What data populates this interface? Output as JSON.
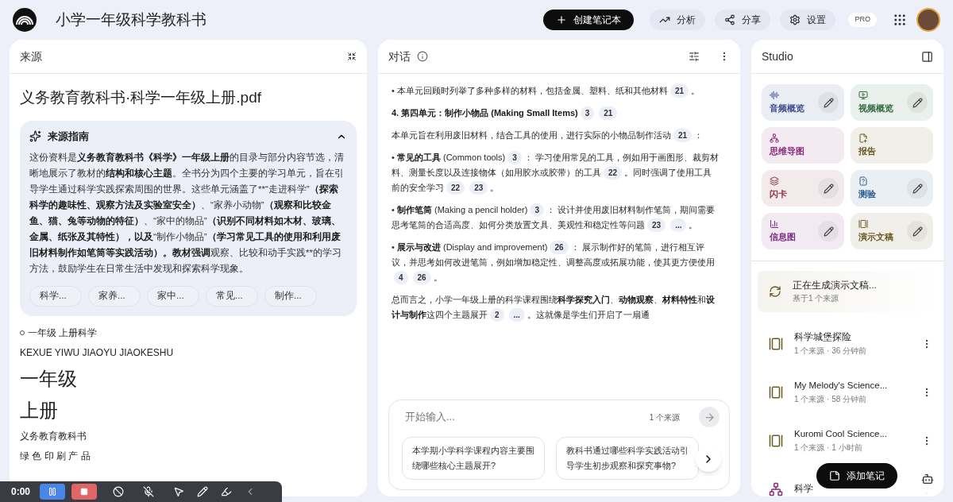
{
  "header": {
    "title": "小学一年级科学教科书",
    "actions": [
      {
        "kind": "primary",
        "label": "创建笔记本"
      },
      {
        "kind": "analytics",
        "label": "分析"
      },
      {
        "kind": "share",
        "label": "分享"
      },
      {
        "kind": "settings",
        "label": "设置"
      }
    ],
    "badge": "PRO"
  },
  "sources": {
    "title": "来源",
    "file_title": "义务教育教科书·科学一年级上册.pdf",
    "guide": {
      "title": "来源指南",
      "expanded": true,
      "parts": [
        {
          "text": "这份资料是",
          "bold": false
        },
        {
          "text": "义务教育教科书《科学》一年级上册",
          "bold": true
        },
        {
          "text": "的目录与部分内容节选，清晰地展示了教材的",
          "bold": false
        },
        {
          "text": "结构和核心主题",
          "bold": true
        },
        {
          "text": "。全书分为四个主要的学习单元，旨在引导学生通过科学实践探索周围的世界。这些单元涵盖了**“走进科学”",
          "bold": false
        },
        {
          "text": "（探索科学的趣味性、观察方法及实验室安全）",
          "bold": true
        },
        {
          "text": "、“家养小动物”",
          "bold": false
        },
        {
          "text": "（观察和比较金鱼、猫、兔等动物的特征）",
          "bold": true
        },
        {
          "text": "、“家中的物品”",
          "bold": false
        },
        {
          "text": "（识别不同材料如木材、玻璃、金属、纸张及其特性），以及",
          "bold": true
        },
        {
          "text": "“制作小物品”",
          "bold": false
        },
        {
          "text": "（学习常见工具的使用和利用废旧材料制作如笔筒等实践活动）。教材强调",
          "bold": true
        },
        {
          "text": "观察、比较和动手实践**的学习方法，鼓励学生在日常生活中发现和探索科学现象。",
          "bold": false
        }
      ],
      "chips": [
        "科学...",
        "家养...",
        "家中...",
        "常见...",
        "制作..."
      ]
    },
    "content": [
      {
        "kind": "marked",
        "text": "一年级 上册科学"
      },
      {
        "kind": "body",
        "text": "KEXUE YIWU JIAOYU JIAOKESHU"
      },
      {
        "kind": "heading",
        "text": "一年级"
      },
      {
        "kind": "heading",
        "text": "上册"
      },
      {
        "kind": "body",
        "text": "义务教育教科书"
      },
      {
        "kind": "body",
        "text": "绿 色 印 刷 产 品"
      }
    ]
  },
  "chat": {
    "title": "对话",
    "paragraphs": [
      {
        "parts": [
          {
            "kind": "text",
            "text": "• 本单元回顾时列举了多种多样的材料，包括金属、塑料、纸和其他材料",
            "bold": false
          },
          {
            "kind": "cite",
            "text": "21"
          },
          {
            "kind": "text",
            "text": "。",
            "bold": false
          }
        ]
      },
      {
        "parts": [
          {
            "kind": "text",
            "text": "4. 第四单元：制作小物品 (Making Small Items)",
            "bold": true
          },
          {
            "kind": "cite",
            "text": "3"
          },
          {
            "kind": "cite",
            "text": "21"
          }
        ]
      },
      {
        "parts": [
          {
            "kind": "text",
            "text": "本单元旨在利用废旧材料，结合工具的使用，进行实际的小物品制作活动",
            "bold": false
          },
          {
            "kind": "cite",
            "text": "21"
          },
          {
            "kind": "text",
            "text": "：",
            "bold": false
          }
        ]
      },
      {
        "parts": [
          {
            "kind": "text",
            "text": "• ",
            "bold": false
          },
          {
            "kind": "text",
            "text": "常见的工具",
            "bold": true
          },
          {
            "kind": "text",
            "text": " (Common tools)",
            "bold": false
          },
          {
            "kind": "cite",
            "text": "3"
          },
          {
            "kind": "text",
            "text": "： 学习使用常见的工具，例如用于画图形、裁剪材料、测量长度以及连接物体（如用胶水或胶带）的工具",
            "bold": false
          },
          {
            "kind": "cite",
            "text": "22"
          },
          {
            "kind": "text",
            "text": "。同时强调了使用工具前的安全学习",
            "bold": false
          },
          {
            "kind": "cite",
            "text": "22"
          },
          {
            "kind": "cite",
            "text": "23"
          },
          {
            "kind": "text",
            "text": "。",
            "bold": false
          }
        ]
      },
      {
        "parts": [
          {
            "kind": "text",
            "text": "• ",
            "bold": false
          },
          {
            "kind": "text",
            "text": "制作笔筒",
            "bold": true
          },
          {
            "kind": "text",
            "text": " (Making a pencil holder)",
            "bold": false
          },
          {
            "kind": "cite",
            "text": "3"
          },
          {
            "kind": "text",
            "text": "： 设计并使用废旧材料制作笔筒，期间需要思考笔筒的合适高度、如何分类放置文具、美观性和稳定性等问题",
            "bold": false
          },
          {
            "kind": "cite",
            "text": "23"
          },
          {
            "kind": "cite",
            "text": "..."
          },
          {
            "kind": "text",
            "text": "。",
            "bold": false
          }
        ]
      },
      {
        "parts": [
          {
            "kind": "text",
            "text": "• ",
            "bold": false
          },
          {
            "kind": "text",
            "text": "展示与改进",
            "bold": true
          },
          {
            "kind": "text",
            "text": " (Display and improvement)",
            "bold": false
          },
          {
            "kind": "cite",
            "text": "26"
          },
          {
            "kind": "text",
            "text": "： 展示制作好的笔筒，进行相互评议，并思考如何改进笔筒，例如增加稳定性、调整高度或拓展功能，使其更方便使用",
            "bold": false
          },
          {
            "kind": "cite",
            "text": "4"
          },
          {
            "kind": "cite",
            "text": "26"
          },
          {
            "kind": "text",
            "text": "。",
            "bold": false
          }
        ]
      },
      {
        "parts": [
          {
            "kind": "text",
            "text": "总而言之，小学一年级上册的科学课程围绕",
            "bold": false
          },
          {
            "kind": "text",
            "text": "科学探究入门",
            "bold": true
          },
          {
            "kind": "text",
            "text": "、",
            "bold": false
          },
          {
            "kind": "text",
            "text": "动物观察",
            "bold": true
          },
          {
            "kind": "text",
            "text": "、",
            "bold": false
          },
          {
            "kind": "text",
            "text": "材料特性",
            "bold": true
          },
          {
            "kind": "text",
            "text": "和",
            "bold": false
          },
          {
            "kind": "text",
            "text": "设计与制作",
            "bold": true
          },
          {
            "kind": "text",
            "text": "这四个主题展开",
            "bold": false
          },
          {
            "kind": "cite",
            "text": "2"
          },
          {
            "kind": "cite",
            "text": "..."
          },
          {
            "kind": "text",
            "text": "。这就像是学生们开启了一扇通",
            "bold": false
          }
        ]
      }
    ],
    "input": {
      "placeholder": "开始输入...",
      "source_count": "1 个来源"
    },
    "suggestions": [
      "本学期小学科学课程内容主要围绕哪些核心主题展开?",
      "教科书通过哪些科学实践活动引导学生初步观察和探究事物?"
    ]
  },
  "studio": {
    "title": "Studio",
    "tiles": [
      {
        "kind": "audio",
        "label": "音频概览",
        "color": "#3b4b8c",
        "editable": true
      },
      {
        "kind": "video",
        "label": "视频概览",
        "color": "#2f6b3c",
        "editable": true
      },
      {
        "kind": "mindmap",
        "label": "思维导图",
        "color": "#8a2a7c",
        "editable": false
      },
      {
        "kind": "report",
        "label": "报告",
        "color": "#6b5a22",
        "editable": false
      },
      {
        "kind": "flashcards",
        "label": "闪卡",
        "color": "#8a2f3c",
        "editable": true
      },
      {
        "kind": "quiz",
        "label": "测验",
        "color": "#2a5d8c",
        "editable": true
      },
      {
        "kind": "infographic",
        "label": "信息图",
        "color": "#7a2a80",
        "editable": true
      },
      {
        "kind": "slides",
        "label": "演示文稿",
        "color": "#6b5a22",
        "editable": true
      }
    ],
    "notes": [
      {
        "kind": "generating",
        "title": "正在生成演示文稿...",
        "subtitle": "基于1 个来源"
      },
      {
        "kind": "slides",
        "title": "科学城堡探险",
        "subtitle": "1 个来源 · 36 分钟前"
      },
      {
        "kind": "slides",
        "title": "My Melody's Science...",
        "subtitle": "1 个来源 · 58 分钟前"
      },
      {
        "kind": "slides",
        "title": "Kuromi Cool Science...",
        "subtitle": "1 个来源 · 1 小时前"
      },
      {
        "kind": "mindmap",
        "title": "科学"
      }
    ],
    "add_note": "添加笔记"
  },
  "recorder": {
    "time": "0:00"
  }
}
